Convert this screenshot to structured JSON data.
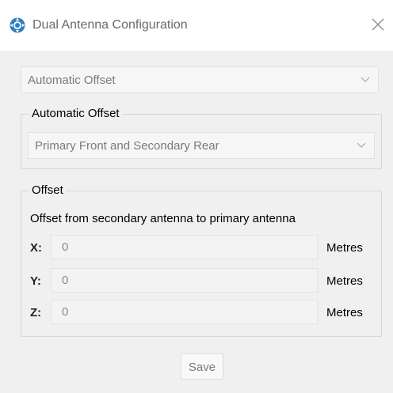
{
  "window": {
    "title": "Dual Antenna Configuration",
    "icon": "antenna-config-icon",
    "close_icon": "close-icon"
  },
  "mode_select": {
    "selected": "Automatic Offset"
  },
  "automatic_offset_group": {
    "legend": "Automatic Offset",
    "placement_select": {
      "selected": "Primary Front and Secondary Rear"
    }
  },
  "offset_group": {
    "legend": "Offset",
    "description": "Offset from secondary antenna to primary antenna",
    "rows": [
      {
        "axis": "X:",
        "value": "0",
        "unit": "Metres"
      },
      {
        "axis": "Y:",
        "value": "0",
        "unit": "Metres"
      },
      {
        "axis": "Z:",
        "value": "0",
        "unit": "Metres"
      }
    ]
  },
  "footer": {
    "save_label": "Save"
  },
  "colors": {
    "titlebar_bg": "#ffffff",
    "body_bg": "#f0f0f0",
    "icon_blue": "#2f7fc1",
    "disabled_text": "#7a7a7a"
  }
}
